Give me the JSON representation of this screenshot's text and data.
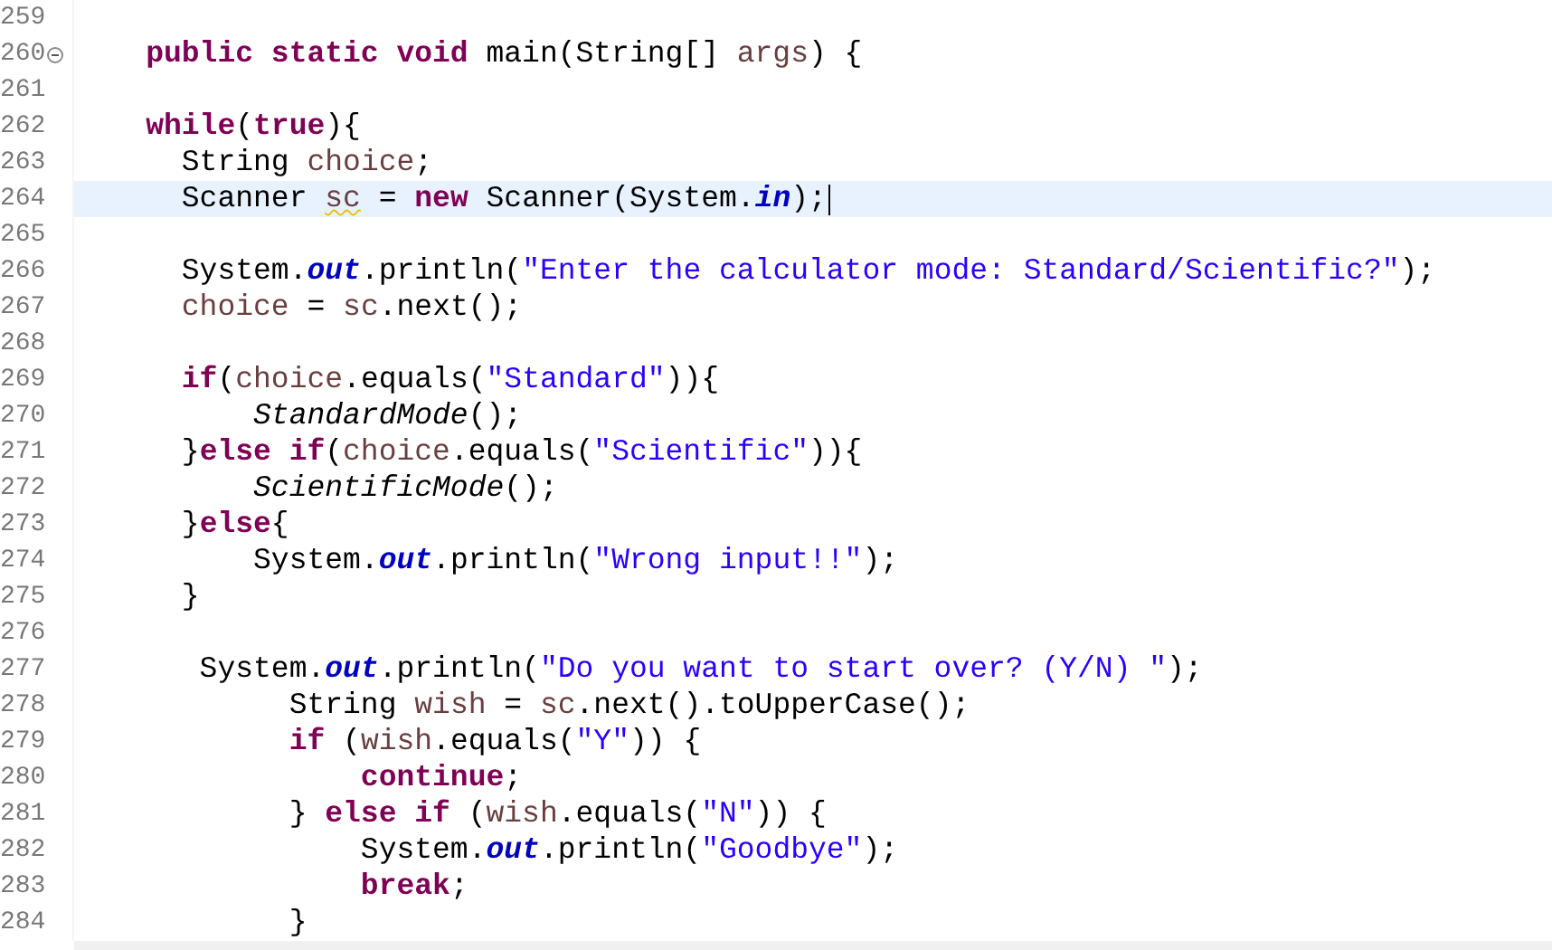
{
  "editor": {
    "lines": [
      {
        "number": "259",
        "current": false
      },
      {
        "number": "260",
        "current": false,
        "fold": {
          "expanded": true
        },
        "tokens": [
          {
            "kind": "keyword",
            "text": "    public static void"
          },
          {
            "kind": "plain",
            "text": " main(String[] "
          },
          {
            "kind": "local",
            "text": "args"
          },
          {
            "kind": "plain",
            "text": ") {"
          }
        ]
      },
      {
        "number": "261",
        "current": false
      },
      {
        "number": "262",
        "current": false,
        "tokens": [
          {
            "kind": "keyword",
            "text": "    while"
          },
          {
            "kind": "plain",
            "text": "("
          },
          {
            "kind": "keyword",
            "text": "true"
          },
          {
            "kind": "plain",
            "text": "){"
          }
        ]
      },
      {
        "number": "263",
        "current": false,
        "tokens": [
          {
            "kind": "plain",
            "text": "      String "
          },
          {
            "kind": "local",
            "text": "choice"
          },
          {
            "kind": "plain",
            "text": ";"
          }
        ]
      },
      {
        "number": "264",
        "current": true,
        "tokens": [
          {
            "kind": "plain",
            "text": "      Scanner "
          },
          {
            "kind": "warning",
            "text": "sc"
          },
          {
            "kind": "plain",
            "text": " = "
          },
          {
            "kind": "keyword",
            "text": "new"
          },
          {
            "kind": "plain",
            "text": " Scanner(System."
          },
          {
            "kind": "field",
            "text": "in"
          },
          {
            "kind": "plain",
            "text": ");"
          }
        ]
      },
      {
        "number": "265",
        "current": false
      },
      {
        "number": "266",
        "current": false,
        "tokens": [
          {
            "kind": "plain",
            "text": "      System."
          },
          {
            "kind": "field",
            "text": "out"
          },
          {
            "kind": "plain",
            "text": ".println("
          },
          {
            "kind": "string",
            "text": "\"Enter the calculator mode: Standard/Scientific?\""
          },
          {
            "kind": "plain",
            "text": ");"
          }
        ]
      },
      {
        "number": "267",
        "current": false,
        "tokens": [
          {
            "kind": "local",
            "text": "      choice"
          },
          {
            "kind": "plain",
            "text": " = "
          },
          {
            "kind": "local",
            "text": "sc"
          },
          {
            "kind": "plain",
            "text": ".next();"
          }
        ]
      },
      {
        "number": "268",
        "current": false
      },
      {
        "number": "269",
        "current": false,
        "tokens": [
          {
            "kind": "keyword",
            "text": "      if"
          },
          {
            "kind": "plain",
            "text": "("
          },
          {
            "kind": "local",
            "text": "choice"
          },
          {
            "kind": "plain",
            "text": ".equals("
          },
          {
            "kind": "string",
            "text": "\"Standard\""
          },
          {
            "kind": "plain",
            "text": ")){"
          }
        ]
      },
      {
        "number": "270",
        "current": false,
        "tokens": [
          {
            "kind": "static-call",
            "text": "          StandardMode"
          },
          {
            "kind": "plain",
            "text": "();"
          }
        ]
      },
      {
        "number": "271",
        "current": false,
        "tokens": [
          {
            "kind": "plain",
            "text": "      }"
          },
          {
            "kind": "keyword",
            "text": "else if"
          },
          {
            "kind": "plain",
            "text": "("
          },
          {
            "kind": "local",
            "text": "choice"
          },
          {
            "kind": "plain",
            "text": ".equals("
          },
          {
            "kind": "string",
            "text": "\"Scientific\""
          },
          {
            "kind": "plain",
            "text": ")){"
          }
        ]
      },
      {
        "number": "272",
        "current": false,
        "tokens": [
          {
            "kind": "static-call",
            "text": "          ScientificMode"
          },
          {
            "kind": "plain",
            "text": "();"
          }
        ]
      },
      {
        "number": "273",
        "current": false,
        "tokens": [
          {
            "kind": "plain",
            "text": "      }"
          },
          {
            "kind": "keyword",
            "text": "else"
          },
          {
            "kind": "plain",
            "text": "{"
          }
        ]
      },
      {
        "number": "274",
        "current": false,
        "tokens": [
          {
            "kind": "plain",
            "text": "          System."
          },
          {
            "kind": "field",
            "text": "out"
          },
          {
            "kind": "plain",
            "text": ".println("
          },
          {
            "kind": "string",
            "text": "\"Wrong input!!\""
          },
          {
            "kind": "plain",
            "text": ");"
          }
        ]
      },
      {
        "number": "275",
        "current": false,
        "tokens": [
          {
            "kind": "plain",
            "text": "      }"
          }
        ]
      },
      {
        "number": "276",
        "current": false
      },
      {
        "number": "277",
        "current": false,
        "tokens": [
          {
            "kind": "plain",
            "text": "       System."
          },
          {
            "kind": "field",
            "text": "out"
          },
          {
            "kind": "plain",
            "text": ".println("
          },
          {
            "kind": "string",
            "text": "\"Do you want to start over? (Y/N) \""
          },
          {
            "kind": "plain",
            "text": ");"
          }
        ]
      },
      {
        "number": "278",
        "current": false,
        "tokens": [
          {
            "kind": "plain",
            "text": "            String "
          },
          {
            "kind": "local",
            "text": "wish"
          },
          {
            "kind": "plain",
            "text": " = "
          },
          {
            "kind": "local",
            "text": "sc"
          },
          {
            "kind": "plain",
            "text": ".next().toUpperCase();"
          }
        ]
      },
      {
        "number": "279",
        "current": false,
        "tokens": [
          {
            "kind": "keyword",
            "text": "            if"
          },
          {
            "kind": "plain",
            "text": " ("
          },
          {
            "kind": "local",
            "text": "wish"
          },
          {
            "kind": "plain",
            "text": ".equals("
          },
          {
            "kind": "string",
            "text": "\"Y\""
          },
          {
            "kind": "plain",
            "text": ")) {"
          }
        ]
      },
      {
        "number": "280",
        "current": false,
        "tokens": [
          {
            "kind": "keyword",
            "text": "                continue"
          },
          {
            "kind": "plain",
            "text": ";"
          }
        ]
      },
      {
        "number": "281",
        "current": false,
        "tokens": [
          {
            "kind": "plain",
            "text": "            } "
          },
          {
            "kind": "keyword",
            "text": "else if"
          },
          {
            "kind": "plain",
            "text": " ("
          },
          {
            "kind": "local",
            "text": "wish"
          },
          {
            "kind": "plain",
            "text": ".equals("
          },
          {
            "kind": "string",
            "text": "\"N\""
          },
          {
            "kind": "plain",
            "text": ")) {"
          }
        ]
      },
      {
        "number": "282",
        "current": false,
        "tokens": [
          {
            "kind": "plain",
            "text": "                System."
          },
          {
            "kind": "field",
            "text": "out"
          },
          {
            "kind": "plain",
            "text": ".println("
          },
          {
            "kind": "string",
            "text": "\"Goodbye\""
          },
          {
            "kind": "plain",
            "text": ");"
          }
        ]
      },
      {
        "number": "283",
        "current": false,
        "tokens": [
          {
            "kind": "keyword",
            "text": "                break"
          },
          {
            "kind": "plain",
            "text": ";"
          }
        ]
      },
      {
        "number": "284",
        "current": false,
        "tokens": [
          {
            "kind": "plain",
            "text": "            }"
          }
        ]
      }
    ]
  }
}
